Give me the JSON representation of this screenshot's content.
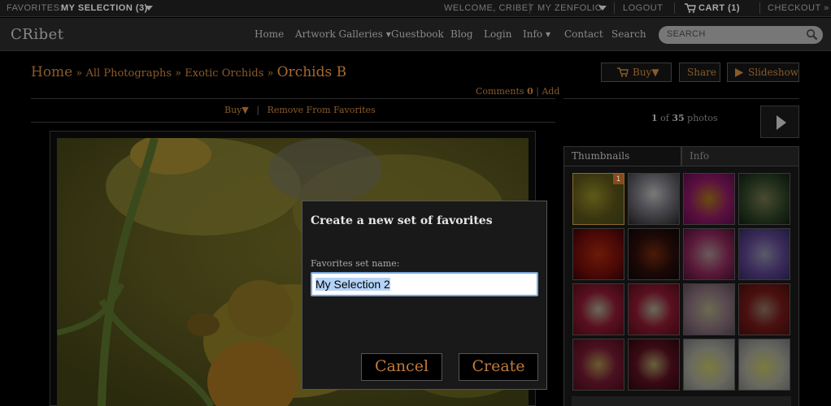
{
  "topbar": {
    "favorites_label": "FAVORITES:",
    "favorites_value": "MY SELECTION (3)",
    "welcome": "WELCOME, CRIBET",
    "my_zenfolio": "MY ZENFOLIO",
    "logout": "LOGOUT",
    "cart": "CART (1)",
    "checkout": "CHECKOUT »"
  },
  "navbar": {
    "logo": "CRibet",
    "items": [
      "Home",
      "Artwork Galleries ▾",
      "Guestbook",
      "Blog",
      "Login",
      "Info ▾",
      "Contact",
      "Search"
    ],
    "search_placeholder": "SEARCH"
  },
  "breadcrumb": {
    "home": "Home",
    "sep": "»",
    "all": "All Photographs",
    "exotic": "Exotic Orchids",
    "current": "Orchids B"
  },
  "comments": {
    "label": "Comments",
    "count": "0",
    "divider": "|",
    "add": "Add"
  },
  "photo_actions": {
    "buy": "Buy▼",
    "divider": "|",
    "remove": "Remove From Favorites"
  },
  "toolbar": {
    "buy": "Buy▼",
    "share": "Share",
    "slideshow": "Slideshow"
  },
  "counter": {
    "current": "1",
    "of": "of",
    "total": "35",
    "unit": "photos"
  },
  "tabs": {
    "thumbnails": "Thumbnails",
    "info": "Info"
  },
  "thumbnail_badge": "1",
  "dialog": {
    "title": "Create a new set of favorites",
    "field_label": "Favorites set name:",
    "field_value": "My Selection 2",
    "cancel": "Cancel",
    "create": "Create"
  },
  "colors": {
    "accent": "#a46a30",
    "input_focus": "#7aa7d6",
    "selection": "#b5d3f7"
  }
}
